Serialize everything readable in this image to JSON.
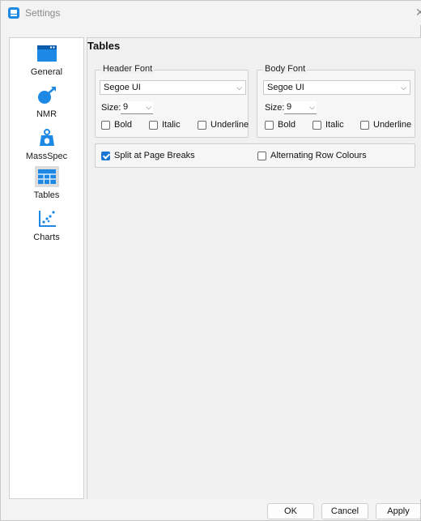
{
  "window": {
    "title": "Settings",
    "close_glyph": "✕"
  },
  "sidebar": {
    "items": [
      {
        "label": "General",
        "icon": "window-icon"
      },
      {
        "label": "NMR",
        "icon": "magnet-icon"
      },
      {
        "label": "MassSpec",
        "icon": "mass-weight-icon"
      },
      {
        "label": "Tables",
        "icon": "table-icon",
        "selected": true
      },
      {
        "label": "Charts",
        "icon": "scatter-chart-icon"
      }
    ]
  },
  "panel": {
    "title": "Tables",
    "header_font": {
      "group_label": "Header Font",
      "font_value": "Segoe UI",
      "size_label": "Size:",
      "size_value": "9",
      "bold_label": "Bold",
      "italic_label": "Italic",
      "underline_label": "Underline"
    },
    "body_font": {
      "group_label": "Body Font",
      "font_value": "Segoe UI",
      "size_label": "Size:",
      "size_value": "9",
      "bold_label": "Bold",
      "italic_label": "Italic",
      "underline_label": "Underline"
    },
    "options": {
      "split_label": "Split at Page Breaks",
      "split_checked": true,
      "alternating_label": "Alternating Row Colours",
      "alternating_checked": false
    }
  },
  "buttons": {
    "ok": "OK",
    "cancel": "Cancel",
    "apply": "Apply"
  },
  "colors": {
    "accent": "#1976d2",
    "icon_blue": "#1e88e5"
  }
}
